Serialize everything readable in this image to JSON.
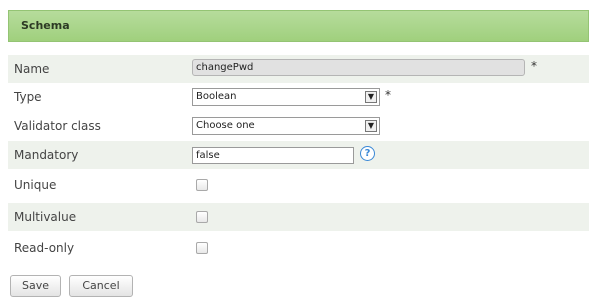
{
  "panel": {
    "title": "Schema"
  },
  "fields": {
    "name": {
      "label": "Name",
      "value": "changePwd",
      "required_mark": "*"
    },
    "type": {
      "label": "Type",
      "selected": "Boolean",
      "required_mark": "*"
    },
    "validator": {
      "label": "Validator class",
      "selected": "Choose one"
    },
    "mandatory": {
      "label": "Mandatory",
      "value": "false",
      "help_icon": "?"
    },
    "unique": {
      "label": "Unique"
    },
    "multivalue": {
      "label": "Multivalue"
    },
    "readonly": {
      "label": "Read-only"
    }
  },
  "buttons": {
    "save": "Save",
    "cancel": "Cancel"
  },
  "colors": {
    "header_bg": "#a8d486",
    "row_shade": "#eef2ec",
    "help_icon": "#3a88d6"
  }
}
